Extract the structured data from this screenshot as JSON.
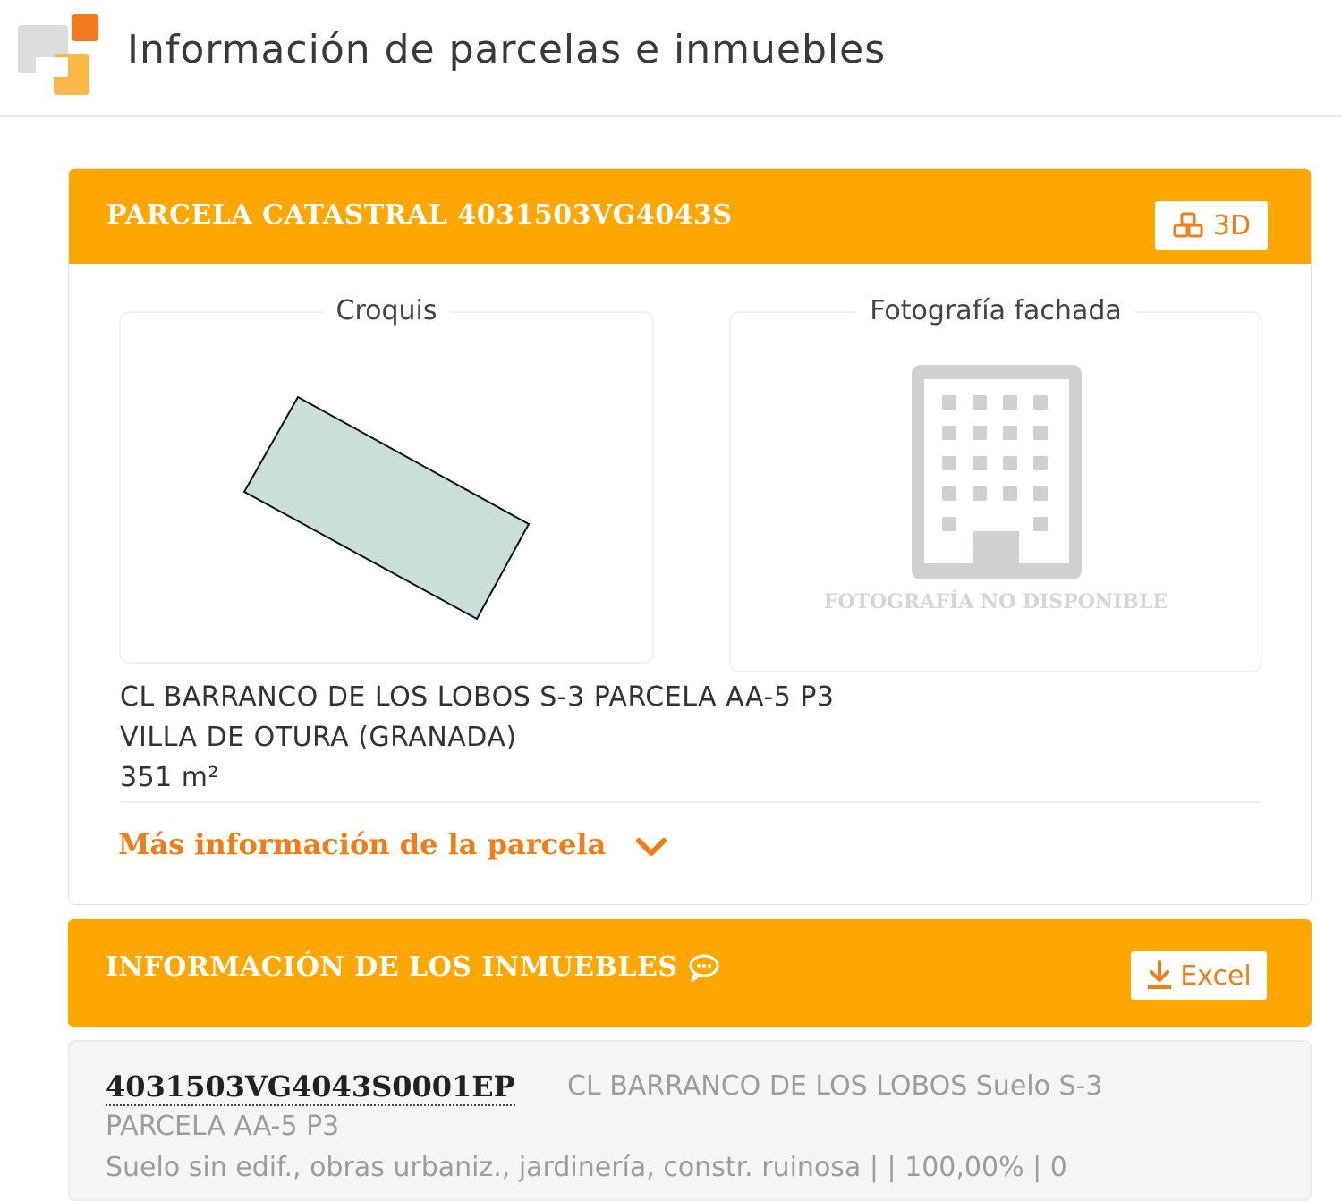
{
  "header": {
    "title": "Información de parcelas e inmuebles"
  },
  "parcel": {
    "title": "PARCELA CATASTRAL 4031503VG4043S",
    "btn_3d": "3D",
    "croquis_label": "Croquis",
    "photo_label": "Fotografía fachada",
    "photo_unavailable": "FOTOGRAFÍA NO DISPONIBLE",
    "address_line1": "CL BARRANCO DE LOS LOBOS S-3 PARCELA AA-5 P3",
    "address_line2": "VILLA DE OTURA (GRANADA)",
    "area": "351 m²",
    "more_info": "Más información de la parcela"
  },
  "properties": {
    "title": "INFORMACIÓN DE LOS INMUEBLES",
    "excel_label": "Excel",
    "items": [
      {
        "ref": "4031503VG4043S0001EP",
        "address_a": "CL BARRANCO DE LOS LOBOS Suelo S-3",
        "address_b": "PARCELA AA-5 P3",
        "detail": "Suelo sin edif., obras urbaniz., jardinería, constr. ruinosa | | 100,00% | 0"
      }
    ]
  },
  "colors": {
    "accent": "#ffa600",
    "link": "#ef7d1a",
    "parcel_fill": "#c8e0d9"
  },
  "icons": {
    "btn_3d": "cubes-icon",
    "excel": "download-icon",
    "comment": "comment-icon",
    "chevron": "chevron-down-icon",
    "building": "building-icon"
  }
}
